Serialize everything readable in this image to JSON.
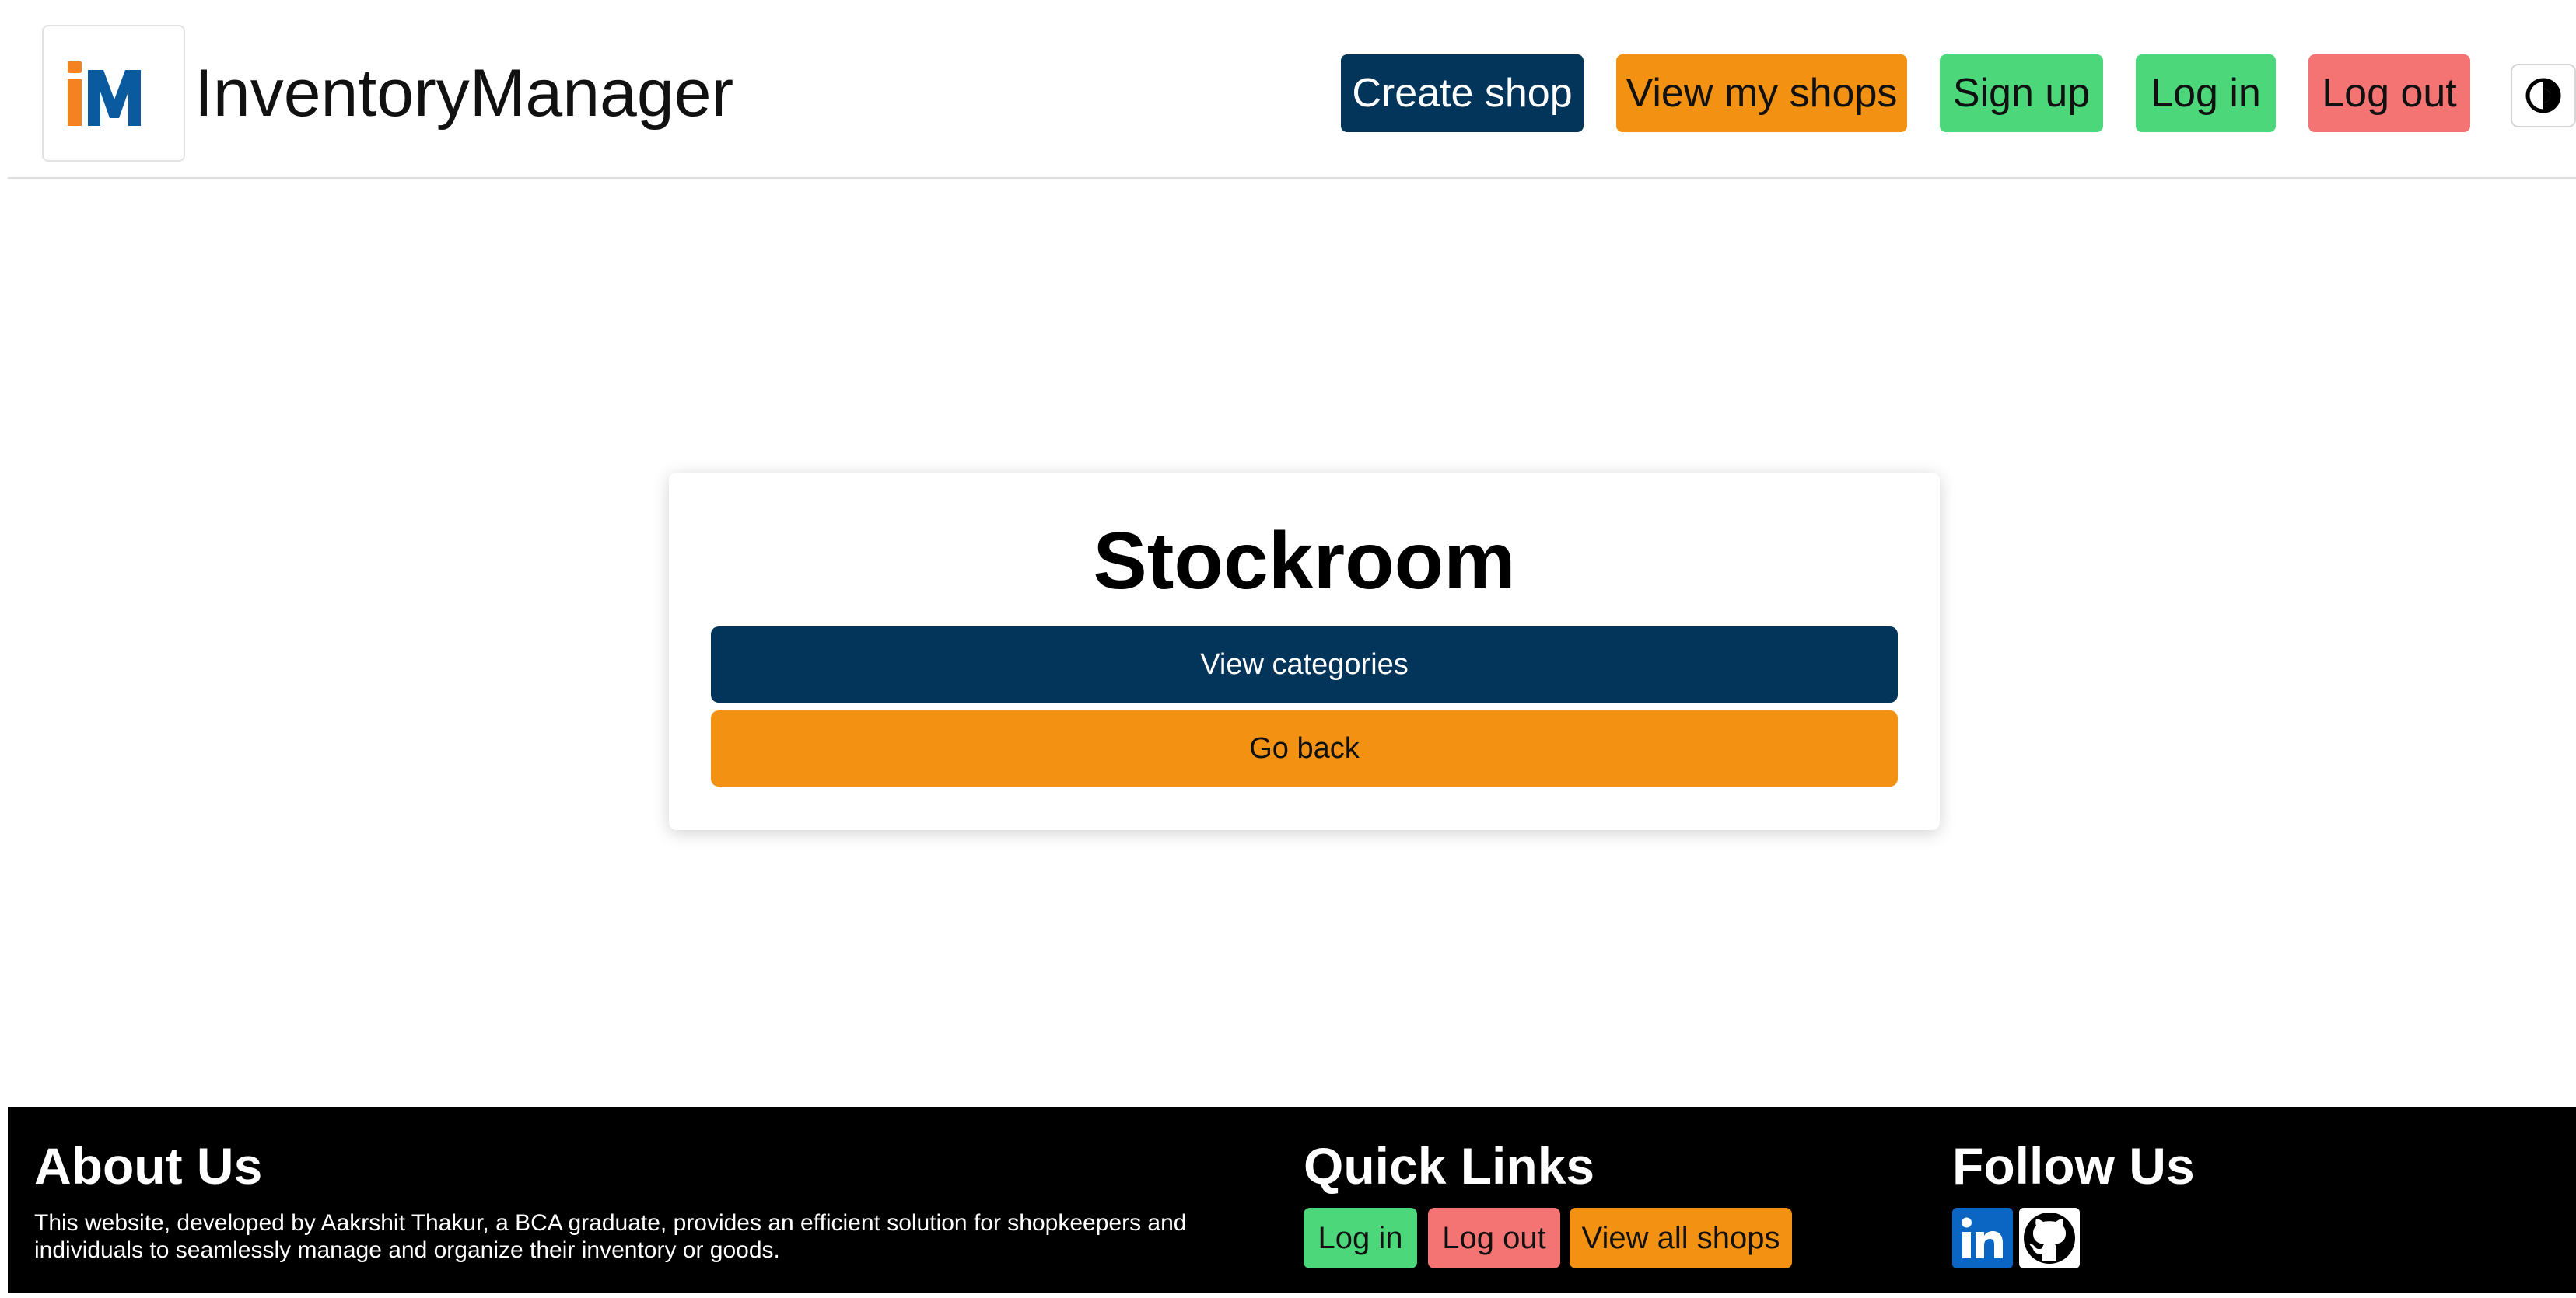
{
  "header": {
    "logo_icon": "im-logo",
    "logo_letters": "iM",
    "brand": "InventoryManager",
    "nav": {
      "create_shop": "Create shop",
      "view_my_shops": "View my shops",
      "sign_up": "Sign up",
      "log_in": "Log in",
      "log_out": "Log out"
    },
    "theme_toggle_icon": "contrast-icon"
  },
  "card": {
    "title": "Stockroom",
    "view_categories": "View categories",
    "go_back": "Go back"
  },
  "footer": {
    "about": {
      "heading": "About Us",
      "text": "This website, developed by Aakrshit Thakur, a BCA graduate, provides an efficient solution for shopkeepers and individuals to seamlessly manage and organize their inventory or goods."
    },
    "quick_links": {
      "heading": "Quick Links",
      "log_in": "Log in",
      "log_out": "Log out",
      "view_all_shops": "View all shops"
    },
    "follow": {
      "heading": "Follow Us",
      "icons": [
        "linkedin-icon",
        "github-icon"
      ]
    }
  },
  "colors": {
    "navy": "#03345a",
    "orange": "#f39212",
    "green": "#4cd77a",
    "red": "#f47373",
    "logo_orange": "#f58220",
    "logo_blue": "#0a5aa0",
    "linkedin_blue": "#0a66c2"
  }
}
